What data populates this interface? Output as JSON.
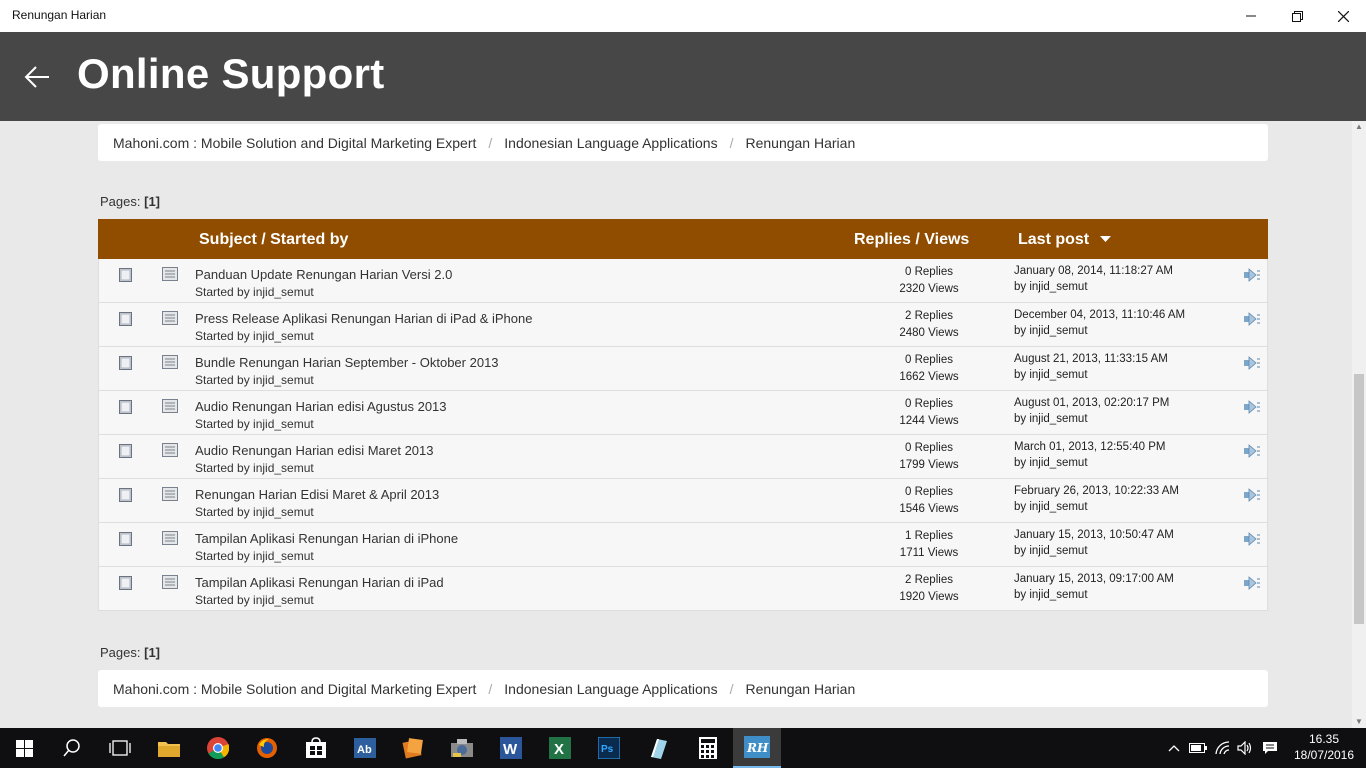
{
  "window": {
    "title": "Renungan Harian"
  },
  "header": {
    "title": "Online Support"
  },
  "breadcrumb": {
    "items": [
      "Mahoni.com : Mobile Solution and Digital Marketing Expert",
      "Indonesian Language Applications",
      "Renungan Harian"
    ],
    "separator": "/"
  },
  "pagination": {
    "label": "Pages:",
    "current": "[1]"
  },
  "table": {
    "headers": {
      "subject": "Subject / Started by",
      "replies_views": "Replies / Views",
      "last_post": "Last post"
    },
    "rows": [
      {
        "subject": "Panduan Update Renungan Harian Versi 2.0",
        "started": "Started by injid_semut",
        "replies": "0 Replies",
        "views": "2320 Views",
        "last_date": "January 08, 2014, 11:18:27 AM",
        "last_by": "by injid_semut"
      },
      {
        "subject": "Press Release Aplikasi Renungan Harian di iPad & iPhone",
        "started": "Started by injid_semut",
        "replies": "2 Replies",
        "views": "2480 Views",
        "last_date": "December 04, 2013, 11:10:46 AM",
        "last_by": "by injid_semut"
      },
      {
        "subject": "Bundle Renungan Harian September - Oktober 2013",
        "started": "Started by injid_semut",
        "replies": "0 Replies",
        "views": "1662 Views",
        "last_date": "August 21, 2013, 11:33:15 AM",
        "last_by": "by injid_semut"
      },
      {
        "subject": "Audio Renungan Harian edisi Agustus 2013",
        "started": "Started by injid_semut",
        "replies": "0 Replies",
        "views": "1244 Views",
        "last_date": "August 01, 2013, 02:20:17 PM",
        "last_by": "by injid_semut"
      },
      {
        "subject": "Audio Renungan Harian edisi Maret 2013",
        "started": "Started by injid_semut",
        "replies": "0 Replies",
        "views": "1799 Views",
        "last_date": "March 01, 2013, 12:55:40 PM",
        "last_by": "by injid_semut"
      },
      {
        "subject": "Renungan Harian Edisi Maret & April 2013",
        "started": "Started by injid_semut",
        "replies": "0 Replies",
        "views": "1546 Views",
        "last_date": "February 26, 2013, 10:22:33 AM",
        "last_by": "by injid_semut"
      },
      {
        "subject": "Tampilan Aplikasi Renungan Harian di iPhone",
        "started": "Started by injid_semut",
        "replies": "1 Replies",
        "views": "1711 Views",
        "last_date": "January 15, 2013, 10:50:47 AM",
        "last_by": "by injid_semut"
      },
      {
        "subject": "Tampilan Aplikasi Renungan Harian di iPad",
        "started": "Started by injid_semut",
        "replies": "2 Replies",
        "views": "1920 Views",
        "last_date": "January 15, 2013, 09:17:00 AM",
        "last_by": "by injid_semut"
      }
    ]
  },
  "taskbar": {
    "apps": [
      "start-icon",
      "search-icon",
      "task-view-icon",
      "file-explorer-icon",
      "chrome-icon",
      "firefox-icon",
      "store-icon",
      "dictionary-app-icon",
      "presentation-app-icon",
      "photo-app-icon",
      "word-icon",
      "excel-icon",
      "photoshop-icon",
      "notes-app-icon",
      "calculator-icon",
      "renungan-harian-icon"
    ],
    "time": "16.35",
    "date": "18/07/2016"
  },
  "colors": {
    "header_bg": "#474747",
    "table_header_bg": "#904d00",
    "page_bg": "#e9e9e9",
    "taskbar_bg": "#0f0f12"
  }
}
